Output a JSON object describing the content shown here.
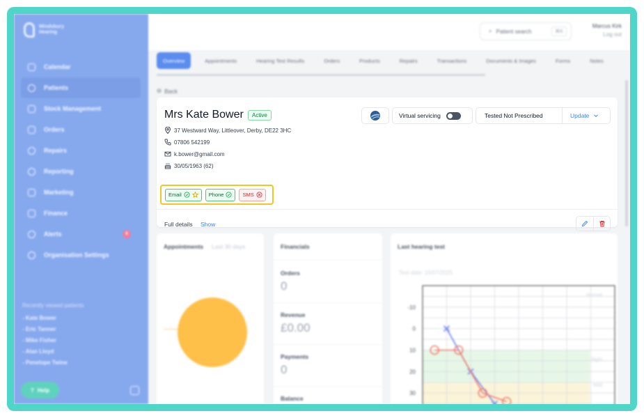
{
  "app": {
    "brand_line1": "Windsbury",
    "brand_line2": "Hearing"
  },
  "sidebar": {
    "items": [
      {
        "label": "Calendar",
        "icon": "calendar-icon"
      },
      {
        "label": "Patients",
        "icon": "patients-icon",
        "active": true
      },
      {
        "label": "Stock Management",
        "icon": "stock-icon"
      },
      {
        "label": "Orders",
        "icon": "orders-icon"
      },
      {
        "label": "Repairs",
        "icon": "wrench-icon"
      },
      {
        "label": "Reporting",
        "icon": "pie-chart-icon"
      },
      {
        "label": "Marketing",
        "icon": "mail-icon"
      },
      {
        "label": "Finance",
        "icon": "card-icon"
      },
      {
        "label": "Alerts",
        "icon": "bell-icon",
        "badge": "6"
      },
      {
        "label": "Organisation Settings",
        "icon": "gear-icon"
      }
    ],
    "recent_title": "Recently viewed patients",
    "recent": [
      "- Kate Bower",
      "- Eric Tanner",
      "- Mike Fisher",
      "- Alan Lloyd",
      "- Penelope Twine"
    ],
    "help_label": "Help"
  },
  "header": {
    "search_placeholder": "Patient search",
    "search_shortcut": "⌘K",
    "user_name": "Marcus Kirk",
    "logout_label": "Log out"
  },
  "tabs": [
    "Overview",
    "Appointments",
    "Hearing Test Results",
    "Orders",
    "Products",
    "Repairs",
    "Transactions",
    "Documents & Images",
    "Forms",
    "Notes"
  ],
  "back_label": "Back",
  "patient": {
    "name": "Mrs Kate Bower",
    "status": "Active",
    "address": "37 Westward Way, Littleover, Derby, DE22 3HC",
    "phone": "07806 542199",
    "email": "k.bower@gmail.com",
    "dob": "30/05/1963 (62)",
    "contact_prefs": [
      {
        "label": "Email",
        "state": "ok",
        "starred": true
      },
      {
        "label": "Phone",
        "state": "ok",
        "starred": false
      },
      {
        "label": "SMS",
        "state": "no",
        "starred": false
      }
    ],
    "virtual_servicing_label": "Virtual servicing",
    "virtual_servicing_on": false,
    "status_text": "Tested Not Prescribed",
    "update_label": "Update",
    "full_details_label": "Full details",
    "show_label": "Show"
  },
  "appointments_card": {
    "title": "Appointments",
    "period": "Last 30 days"
  },
  "financials_card": {
    "title": "Financials",
    "rows": [
      {
        "label": "Orders",
        "value": "0"
      },
      {
        "label": "Revenue",
        "value": "£0.00"
      },
      {
        "label": "Payments",
        "value": "0"
      },
      {
        "label": "Balance",
        "value": ""
      }
    ]
  },
  "hearing_card": {
    "title": "Last hearing test",
    "test_date": "Test date: 15/07/2025",
    "zones": [
      "Normal",
      "Slight",
      "Mild"
    ]
  },
  "chart_data": {
    "type": "line",
    "title": "",
    "xlabel": "",
    "ylabel": "",
    "y_ticks": [
      -10,
      0,
      10,
      20,
      30
    ],
    "ylim": [
      -20,
      40
    ],
    "y_inverted": true,
    "grid": true,
    "series": [
      {
        "marker": "x",
        "color": "#6b7ff0",
        "x": [
          1,
          2,
          3
        ],
        "values": [
          0,
          20,
          35
        ]
      },
      {
        "marker": "o",
        "color": "#ef7a6a",
        "x": [
          0.5,
          1.5,
          2.5,
          3.5
        ],
        "values": [
          10,
          10,
          30,
          34
        ]
      }
    ]
  },
  "colors": {
    "accent": "#5b8def",
    "sidebar": "#86a9ee",
    "frame": "#4fd6c8",
    "highlight": "#f3c623"
  }
}
